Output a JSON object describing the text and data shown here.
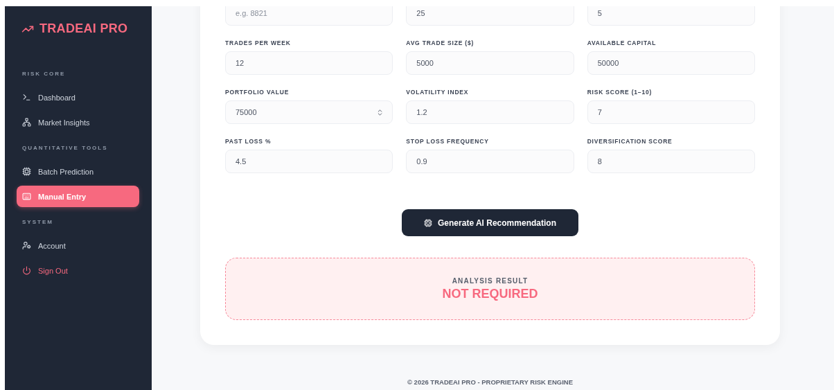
{
  "sidebar": {
    "logo": "TRADEAI PRO",
    "sections": [
      {
        "title": "RISK CORE",
        "items": [
          {
            "label": "Dashboard",
            "selected": false,
            "kind": "normal"
          },
          {
            "label": "Market Insights",
            "selected": false,
            "kind": "normal"
          }
        ]
      },
      {
        "title": "QUANTITATIVE TOOLS",
        "items": [
          {
            "label": "Batch Prediction",
            "selected": false,
            "kind": "normal"
          },
          {
            "label": "Manual Entry",
            "selected": true,
            "kind": "normal"
          }
        ]
      },
      {
        "title": "SYSTEM",
        "items": [
          {
            "label": "Account",
            "selected": false,
            "kind": "normal"
          },
          {
            "label": "Sign Out",
            "selected": false,
            "kind": "danger"
          }
        ]
      }
    ]
  },
  "form": {
    "top_row": [
      {
        "placeholder": "e.g. 8821"
      },
      {
        "value": "25"
      },
      {
        "value": "5"
      }
    ],
    "fields": [
      {
        "label": "TRADES PER WEEK",
        "value": "12",
        "kind": "text"
      },
      {
        "label": "AVG TRADE SIZE ($)",
        "value": "5000",
        "kind": "text"
      },
      {
        "label": "AVAILABLE CAPITAL",
        "value": "50000",
        "kind": "text"
      },
      {
        "label": "PORTFOLIO VALUE",
        "value": "75000",
        "kind": "spinner"
      },
      {
        "label": "VOLATILITY INDEX",
        "value": "1.2",
        "kind": "text"
      },
      {
        "label": "RISK SCORE (1–10)",
        "value": "7",
        "kind": "text"
      },
      {
        "label": "PAST LOSS %",
        "value": "4.5",
        "kind": "text"
      },
      {
        "label": "STOP LOSS FREQUENCY",
        "value": "0.9",
        "kind": "text"
      },
      {
        "label": "DIVERSIFICATION SCORE",
        "value": "8",
        "kind": "text"
      }
    ],
    "submit": "Generate AI Recommendation"
  },
  "result": {
    "title": "ANALYSIS RESULT",
    "value": "NOT REQUIRED"
  },
  "footer": "© 2026 TRADEAI PRO - PROPRIETARY RISK ENGINE"
}
